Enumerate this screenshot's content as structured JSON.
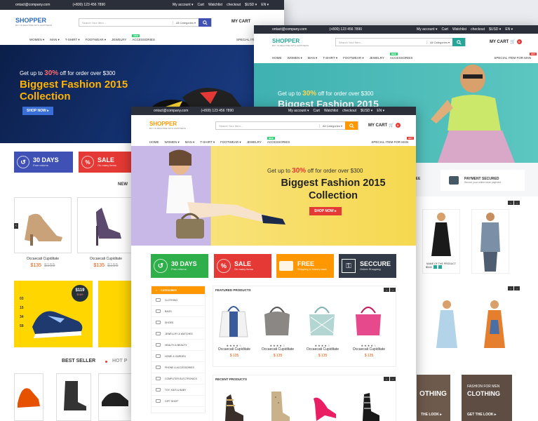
{
  "topbar": {
    "email": "ontact@company.com",
    "phone": "(+800) 123 456 7890",
    "account": "My account ▾",
    "cart": "Cart",
    "watchlist": "Watchlist",
    "checkout": "checkout",
    "currency": "$USD ▾",
    "lang": "EN ▾"
  },
  "brand": {
    "name": "SHOPPER",
    "tagline": "BUY IN REALTIME WITH HAPPINESS"
  },
  "search": {
    "placeholder": "Search Your Item...",
    "category": "All Categories ▾"
  },
  "cart": {
    "label": "MY CART",
    "count": "0"
  },
  "nav": {
    "items": [
      "HOME",
      "WOMEN ▾",
      "MAN ▾",
      "T-SHIRT ▾",
      "FOOTWEAR ▾",
      "JEWELRY",
      "ACCESSORIES"
    ],
    "new_badge": "NEW",
    "hot_badge": "HOT",
    "special": "SPECIAL ITEM FOR MAN"
  },
  "hero": {
    "pre": "Get up to",
    "pct": "30%",
    "post": "off for order over $300",
    "title1": "Biggest Fashion 2015",
    "title2": "Collection",
    "cta": "SHOP NOW ▸"
  },
  "features": [
    {
      "title": "30 DAYS",
      "sub": "Free returns",
      "color": "#2eaf4a"
    },
    {
      "title": "SALE",
      "sub": "On many items",
      "color": "#e53935"
    },
    {
      "title": "FREE",
      "sub": "Shipping & Money back",
      "color": "#ff9800"
    },
    {
      "title": "SECCURE",
      "sub": "Online Shopping",
      "color": "#333a47"
    }
  ],
  "categories": {
    "header": "CATEGORIES",
    "items": [
      "CLOTHING",
      "BAGS",
      "SHOES",
      "JEWELLRY & WATCHES",
      "HEALTH & BEAUTY",
      "HOME & GARDEN",
      "PHONE & ACCESSORIES",
      "COMPUTER ELECTRONICS",
      "TOY, KIDS & BABY",
      "GIFT SHOP"
    ]
  },
  "featured": {
    "title": "FEATURED PRODUCTS",
    "products": [
      {
        "name": "Occaecati Cupiditate",
        "price": "$ 135",
        "stars": "★★★★☆"
      },
      {
        "name": "Occaecati Cupiditate",
        "price": "$ 135",
        "stars": "★★★★☆"
      },
      {
        "name": "Occaecati Cupiditate",
        "price": "$ 135",
        "stars": "★★★★☆"
      },
      {
        "name": "Occaecati Cupiditate",
        "price": "$ 135",
        "stars": "★★★★☆"
      }
    ]
  },
  "recent": {
    "title": "RECENT PRODUCTS"
  },
  "left_window": {
    "products": [
      {
        "name": "Occaecati Cupiditate",
        "price": "$135",
        "old": "$155"
      },
      {
        "name": "Occaecati Cupiditate",
        "price": "$135",
        "old": "$155"
      }
    ],
    "new_label": "NEW",
    "best_seller": "BEST SELLER",
    "hot_label": "HOT P",
    "promo_price": "$119",
    "promo_old": "$169",
    "sizes": [
      "03",
      "15",
      "34",
      "59"
    ]
  },
  "right_window": {
    "guarantee": "NTEE",
    "payment_title": "PAYMENT SECURED",
    "payment_sub": "Secure your online store payment",
    "product_name": "NAME OF THE PRODUCT",
    "product_price": "$540",
    "fashion_label": "FASHION FOR MEN",
    "fashion_big": "CLOTHING",
    "look_cta": "GET THE LOOK ▸",
    "fashion_big_left": "OTHING",
    "look_cta_left": "THE LOOK ▸"
  }
}
